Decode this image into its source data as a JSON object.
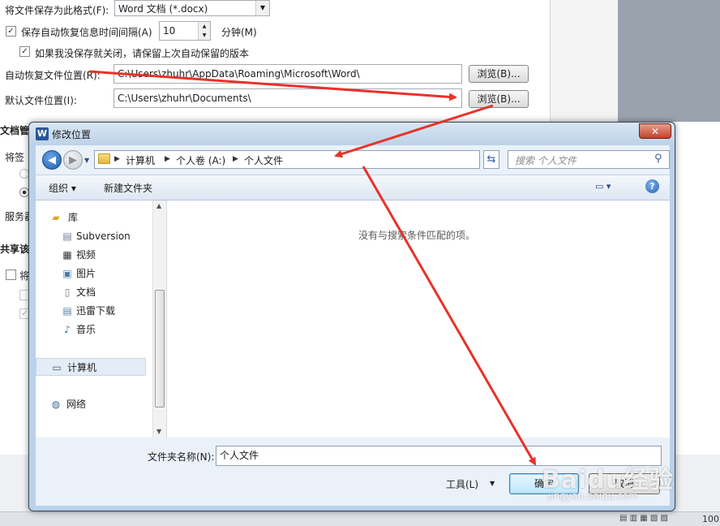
{
  "background": {
    "save_format_label": "将文件保存为此格式(F):",
    "save_format_value": "Word 文档 (*.docx)",
    "autorecover_label": "保存自动恢复信息时间间隔(A)",
    "autorecover_value": "10",
    "minutes_label": "分钟(M)",
    "keep_version_label": "如果我没保存就关闭，请保留上次自动保留的版本",
    "autorecover_location_label": "自动恢复文件位置(R):",
    "autorecover_location_value": "C:\\Users\\zhuhr\\AppData\\Roaming\\Microsoft\\Word\\",
    "default_location_label": "默认文件位置(I):",
    "default_location_value": "C:\\Users\\zhuhr\\Documents\\",
    "browse_label": "浏览(B)...",
    "section_doc_mgmt": "文档管",
    "section_share": "共享该",
    "frag_save_to": "将签",
    "frag_server": "服务器",
    "frag_will": "将"
  },
  "dialog": {
    "title": "修改位置",
    "close_label": "✕",
    "breadcrumbs": [
      "计算机",
      "个人卷 (A:)",
      "个人文件"
    ],
    "search_placeholder": "搜索 个人文件",
    "organize_label": "组织 ▾",
    "new_folder_label": "新建文件夹",
    "empty_message": "没有与搜索条件匹配的项。",
    "nav_items": [
      {
        "label": "库",
        "icon": "library-icon"
      },
      {
        "label": "Subversion",
        "icon": "folder-icon"
      },
      {
        "label": "视频",
        "icon": "video-icon"
      },
      {
        "label": "图片",
        "icon": "pictures-icon"
      },
      {
        "label": "文档",
        "icon": "documents-icon"
      },
      {
        "label": "迅雷下载",
        "icon": "download-icon"
      },
      {
        "label": "音乐",
        "icon": "music-icon"
      },
      {
        "label": "计算机",
        "icon": "computer-icon"
      },
      {
        "label": "网络",
        "icon": "network-icon"
      }
    ],
    "folder_name_label": "文件夹名称(N):",
    "folder_name_value": "个人文件",
    "tools_label": "工具(L)",
    "ok_label": "确定",
    "cancel_label": "取消"
  },
  "watermark": {
    "text": "Baidu经验",
    "sub": "jingyan.baidu.com"
  },
  "status": {
    "zoom": "100"
  },
  "colors": {
    "annotation_arrow": "#e8322a",
    "dialog_frame": "#b9d1ea",
    "close_button": "#c5412c"
  }
}
